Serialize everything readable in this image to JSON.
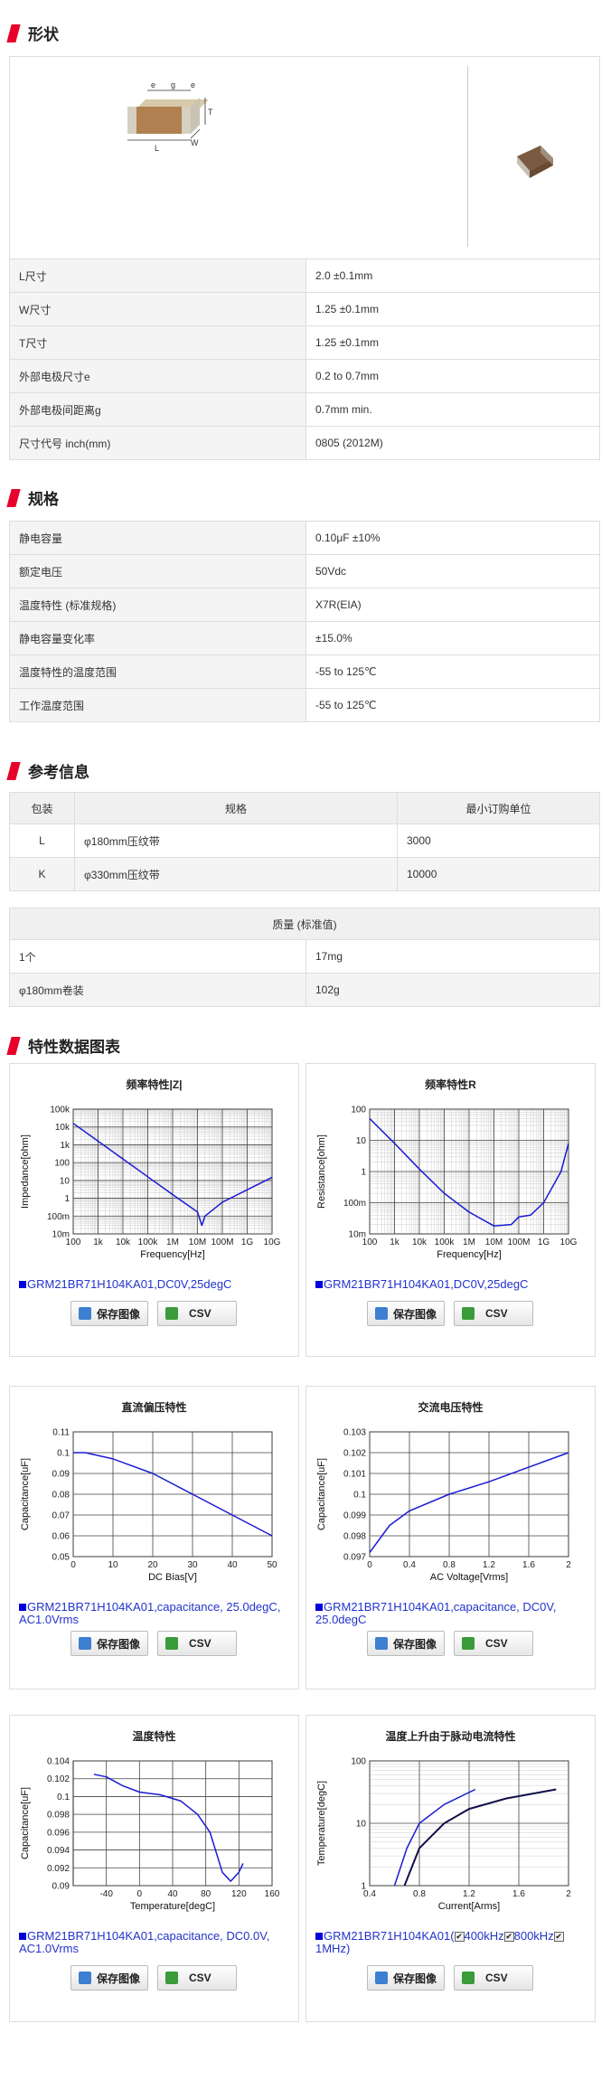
{
  "sections": {
    "shape": "形状",
    "spec": "规格",
    "ref": "参考信息",
    "chart": "特性数据图表"
  },
  "dimension_labels": {
    "e1": "e",
    "g": "g",
    "e2": "e",
    "t": "T",
    "l": "L",
    "w": "W"
  },
  "dimensions": [
    {
      "k": "L尺寸",
      "v": "2.0 ±0.1mm"
    },
    {
      "k": "W尺寸",
      "v": "1.25 ±0.1mm"
    },
    {
      "k": "T尺寸",
      "v": "1.25 ±0.1mm"
    },
    {
      "k": "外部电极尺寸e",
      "v": "0.2 to 0.7mm"
    },
    {
      "k": "外部电极间距离g",
      "v": "0.7mm min."
    },
    {
      "k": "尺寸代号 inch(mm)",
      "v": "0805 (2012M)"
    }
  ],
  "specs": [
    {
      "k": "静电容量",
      "v": "0.10μF ±10%"
    },
    {
      "k": "额定电压",
      "v": "50Vdc"
    },
    {
      "k": "温度特性 (标准规格)",
      "v": "X7R(EIA)"
    },
    {
      "k": "静电容量变化率",
      "v": "±15.0%"
    },
    {
      "k": "温度特性的温度范围",
      "v": "-55 to 125℃"
    },
    {
      "k": "工作温度范围",
      "v": "-55 to 125℃"
    }
  ],
  "packaging": {
    "headers": [
      "包装",
      "规格",
      "最小订购单位"
    ],
    "rows": [
      [
        "L",
        "φ180mm压纹带",
        "3000"
      ],
      [
        "K",
        "φ330mm压纹带",
        "10000"
      ]
    ]
  },
  "mass": {
    "header": "质量 (标准值)",
    "rows": [
      [
        "1个",
        "17mg"
      ],
      [
        "φ180mm卷装",
        "102g"
      ]
    ]
  },
  "buttons": {
    "save": "保存图像",
    "csv": "CSV"
  },
  "colors": {
    "accent": "#e8002a",
    "curve": "#1a1ad4",
    "curve2": "#10104a",
    "caption": "#2233cc"
  },
  "charts": [
    {
      "title": "频率特性|Z|",
      "caption": "GRM21BR71H104KA01,DC0V,25degC"
    },
    {
      "title": "频率特性R",
      "caption": "GRM21BR71H104KA01,DC0V,25degC"
    },
    {
      "title": "直流偏压特性",
      "caption": "GRM21BR71H104KA01,capacitance, 25.0degC, AC1.0Vrms"
    },
    {
      "title": "交流电压特性",
      "caption": "GRM21BR71H104KA01,capacitance, DC0V, 25.0degC"
    },
    {
      "title": "温度特性",
      "caption": "GRM21BR71H104KA01,capacitance, DC0.0V, AC1.0Vrms"
    },
    {
      "title": "温度上升由于脉动电流特性",
      "caption_parts": [
        "GRM21BR71H104KA01(",
        "400kHz",
        "800kHz",
        "1MHz)"
      ]
    }
  ],
  "chart_data": [
    {
      "type": "line",
      "title": "频率特性|Z|",
      "xlabel": "Frequency[Hz]",
      "ylabel": "Impedance[ohm]",
      "x_scale": "log",
      "y_scale": "log",
      "xticks": [
        "100",
        "1k",
        "10k",
        "100k",
        "1M",
        "10M",
        "100M",
        "1G",
        "10G"
      ],
      "yticks": [
        "100k",
        "10k",
        "1k",
        "100",
        "10",
        "1",
        "100m",
        "10m"
      ],
      "series": [
        {
          "x": [
            100,
            1000,
            10000,
            100000,
            1000000,
            10000000,
            15000000,
            20000000,
            100000000,
            1000000000,
            10000000000
          ],
          "y": [
            16000,
            1600,
            160,
            16,
            1.6,
            0.17,
            0.03,
            0.1,
            0.6,
            3,
            15
          ]
        }
      ]
    },
    {
      "type": "line",
      "title": "频率特性R",
      "xlabel": "Frequency[Hz]",
      "ylabel": "Resistance[ohm]",
      "x_scale": "log",
      "y_scale": "log",
      "xticks": [
        "100",
        "1k",
        "10k",
        "100k",
        "1M",
        "10M",
        "100M",
        "1G",
        "10G"
      ],
      "yticks": [
        "100",
        "10",
        "1",
        "100m",
        "10m"
      ],
      "series": [
        {
          "x": [
            100,
            1000,
            10000,
            100000,
            1000000,
            10000000,
            50000000,
            100000000,
            300000000,
            1000000000,
            5000000000,
            10000000000
          ],
          "y": [
            50,
            8,
            1.2,
            0.2,
            0.05,
            0.018,
            0.02,
            0.035,
            0.04,
            0.1,
            1,
            8
          ]
        }
      ]
    },
    {
      "type": "line",
      "title": "直流偏压特性",
      "xlabel": "DC Bias[V]",
      "ylabel": "Capacitance[uF]",
      "xlim": [
        0,
        50
      ],
      "ylim": [
        0.05,
        0.11
      ],
      "xticks": [
        "0",
        "10",
        "20",
        "30",
        "40",
        "50"
      ],
      "yticks": [
        "0.11",
        "0.1",
        "0.09",
        "0.08",
        "0.07",
        "0.06",
        "0.05"
      ],
      "series": [
        {
          "x": [
            0,
            3,
            10,
            20,
            30,
            40,
            50
          ],
          "y": [
            0.1,
            0.1,
            0.097,
            0.09,
            0.08,
            0.07,
            0.06
          ]
        }
      ]
    },
    {
      "type": "line",
      "title": "交流电压特性",
      "xlabel": "AC Voltage[Vrms]",
      "ylabel": "Capacitance[uF]",
      "xlim": [
        0,
        2
      ],
      "ylim": [
        0.097,
        0.103
      ],
      "xticks": [
        "0",
        "0.4",
        "0.8",
        "1.2",
        "1.6",
        "2"
      ],
      "yticks": [
        "0.103",
        "0.102",
        "0.101",
        "0.1",
        "0.099",
        "0.098",
        "0.097"
      ],
      "series": [
        {
          "x": [
            0,
            0.2,
            0.4,
            0.8,
            1.2,
            1.6,
            2
          ],
          "y": [
            0.0972,
            0.0985,
            0.0992,
            0.1,
            0.1006,
            0.1013,
            0.102
          ]
        }
      ]
    },
    {
      "type": "line",
      "title": "温度特性",
      "xlabel": "Temperature[degC]",
      "ylabel": "Capacitance[uF]",
      "xlim": [
        -80,
        160
      ],
      "ylim": [
        0.09,
        0.104
      ],
      "xticks": [
        "-40",
        "0",
        "40",
        "80",
        "120",
        "160"
      ],
      "yticks": [
        "0.104",
        "0.102",
        "0.1",
        "0.098",
        "0.096",
        "0.094",
        "0.092",
        "0.09"
      ],
      "series": [
        {
          "x": [
            -55,
            -40,
            -20,
            0,
            25,
            50,
            70,
            85,
            100,
            110,
            120,
            125
          ],
          "y": [
            0.1025,
            0.1022,
            0.1012,
            0.1005,
            0.1002,
            0.0995,
            0.098,
            0.096,
            0.0915,
            0.0905,
            0.0915,
            0.0925
          ]
        }
      ]
    },
    {
      "type": "line",
      "title": "温度上升由于脉动电流特性",
      "xlabel": "Current[Arms]",
      "ylabel": "Temperature[degC]",
      "x_scale": "linear",
      "y_scale": "log",
      "xlim": [
        0.4,
        2
      ],
      "ylim": [
        1,
        100
      ],
      "xticks": [
        "0.4",
        "0.8",
        "1.2",
        "1.6",
        "2"
      ],
      "yticks": [
        "100",
        "10",
        "1"
      ],
      "series": [
        {
          "name": "400kHz",
          "x": [
            0.6,
            0.7,
            0.8,
            1.0,
            1.25
          ],
          "y": [
            1,
            4,
            10,
            20,
            35
          ]
        },
        {
          "name": "800kHz",
          "x": [
            0.68,
            0.8,
            1.0,
            1.2,
            1.5,
            1.9
          ],
          "y": [
            1,
            4,
            10,
            17,
            25,
            35
          ]
        }
      ]
    }
  ]
}
